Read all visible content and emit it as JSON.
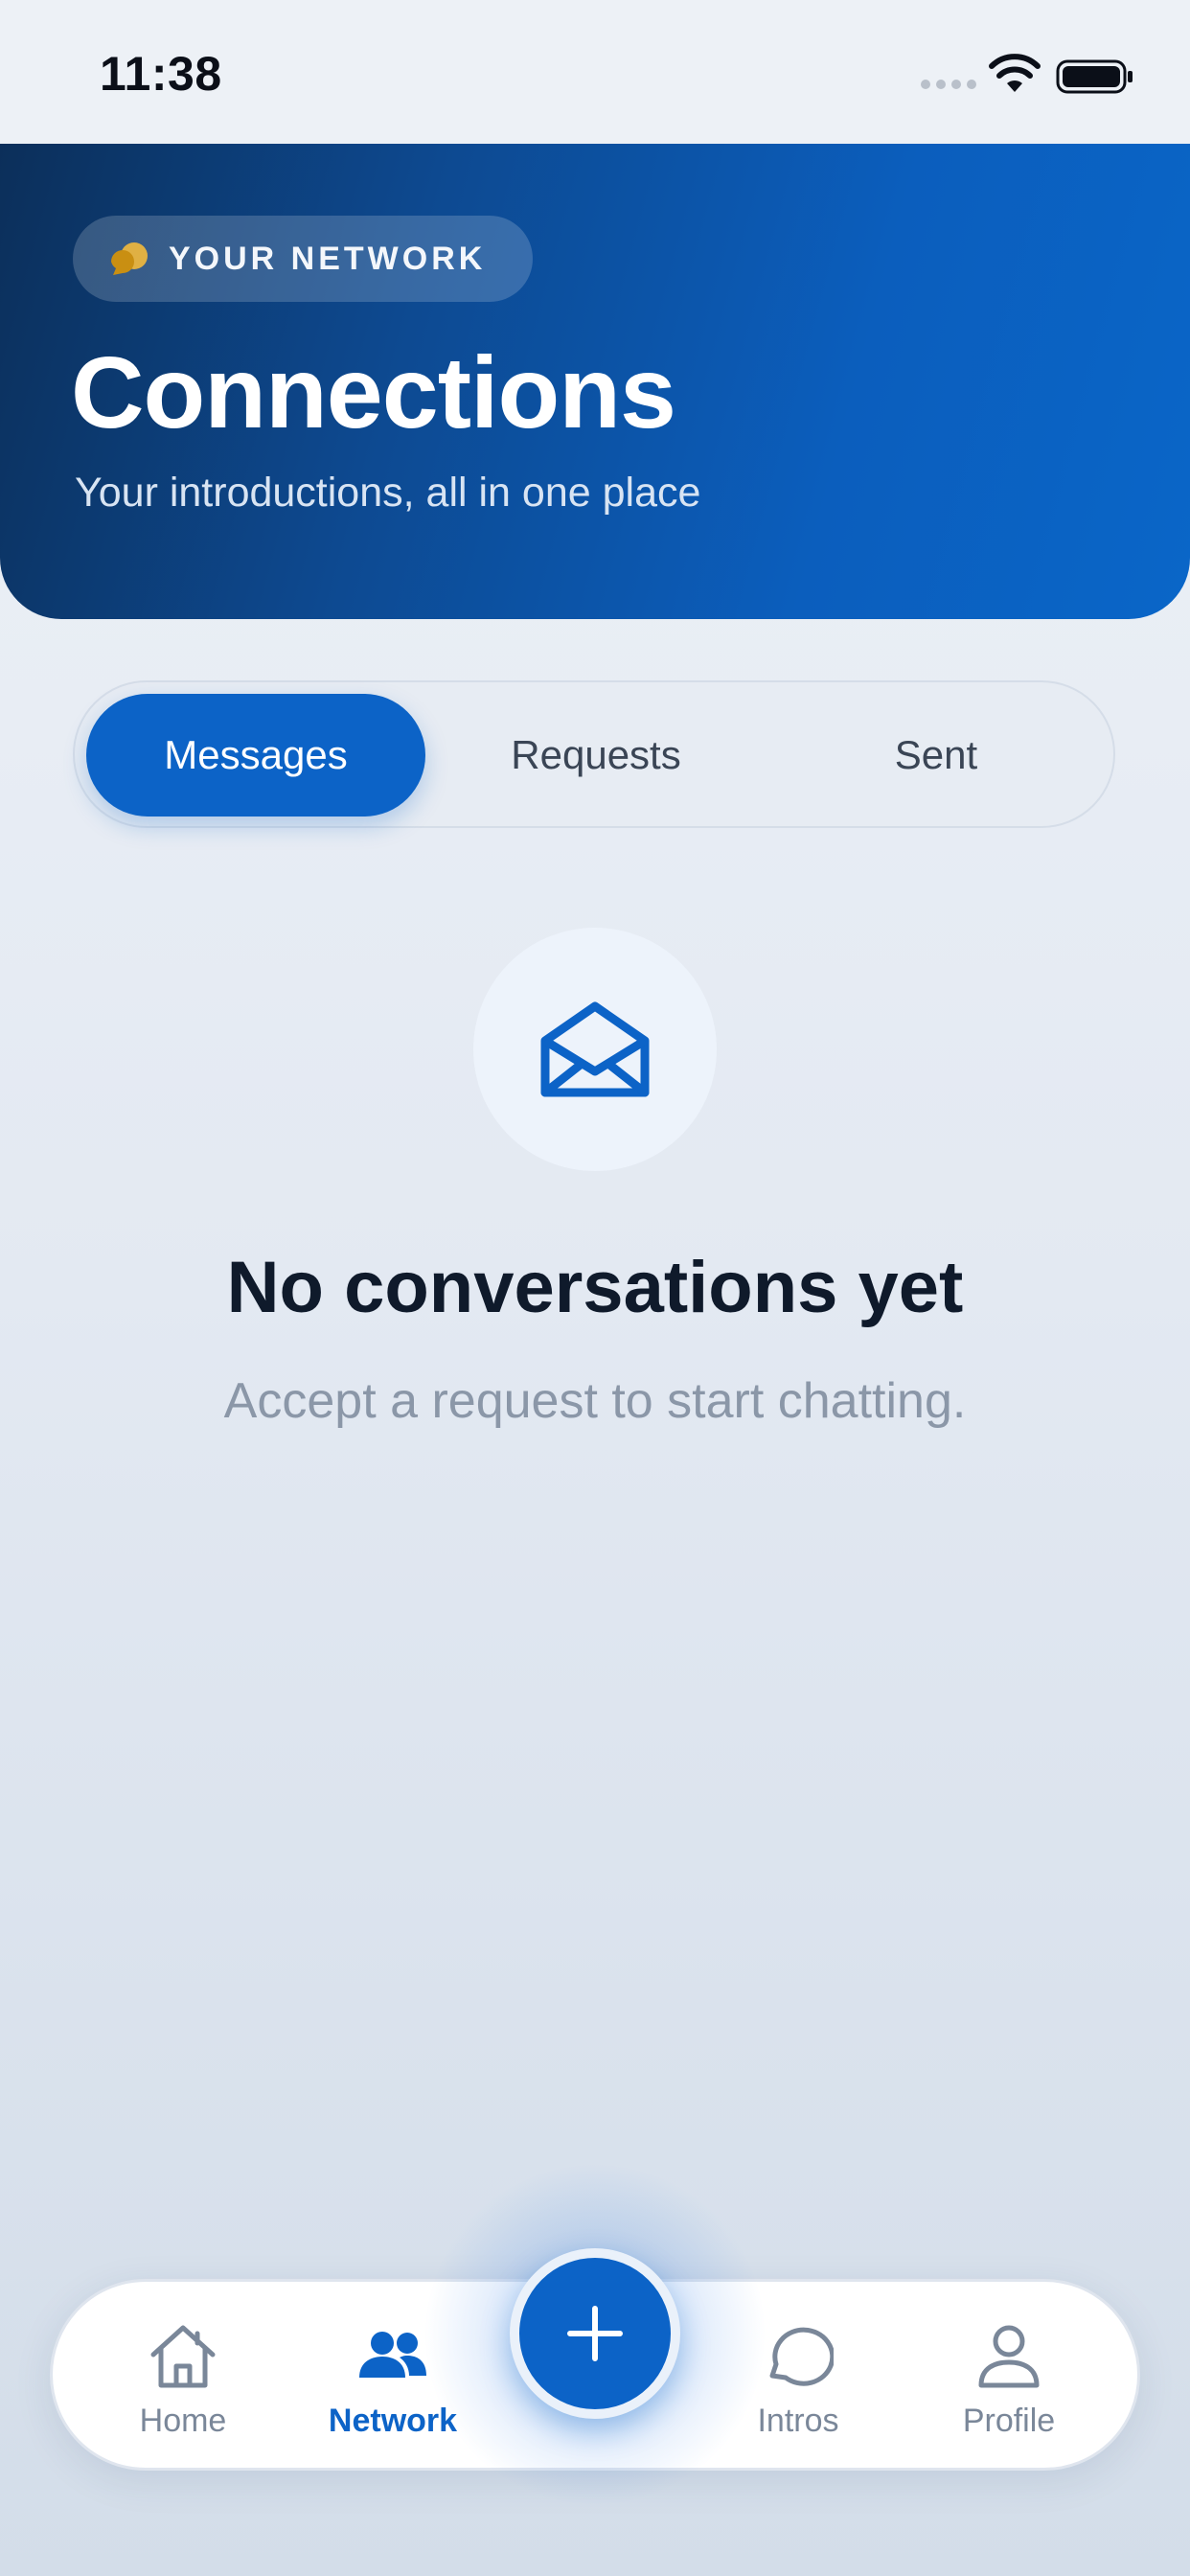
{
  "status_bar": {
    "time": "11:38"
  },
  "header": {
    "chip_label": "YOUR NETWORK",
    "chip_icon": "chat-bubbles-icon",
    "title": "Connections",
    "subtitle": "Your introductions, all in one place"
  },
  "tabs": [
    {
      "label": "Messages",
      "active": true
    },
    {
      "label": "Requests",
      "active": false
    },
    {
      "label": "Sent",
      "active": false
    }
  ],
  "empty_state": {
    "icon": "envelope-open-icon",
    "title": "No conversations yet",
    "message": "Accept a request to start chatting."
  },
  "bottom_nav": {
    "items": [
      {
        "label": "Home",
        "icon": "home-icon",
        "active": false
      },
      {
        "label": "Network",
        "icon": "people-icon",
        "active": true
      },
      {
        "label": "Intros",
        "icon": "chat-bubble-icon",
        "active": false
      },
      {
        "label": "Profile",
        "icon": "person-icon",
        "active": false
      }
    ],
    "fab_icon": "plus-icon"
  },
  "colors": {
    "accent": "#0c63c7",
    "hero_start": "#0c2f5a",
    "hero_end": "#0a66c8",
    "chip_icon": "#d9a21b",
    "text_dark": "#0f1a2b",
    "text_muted": "#8b97a8"
  }
}
